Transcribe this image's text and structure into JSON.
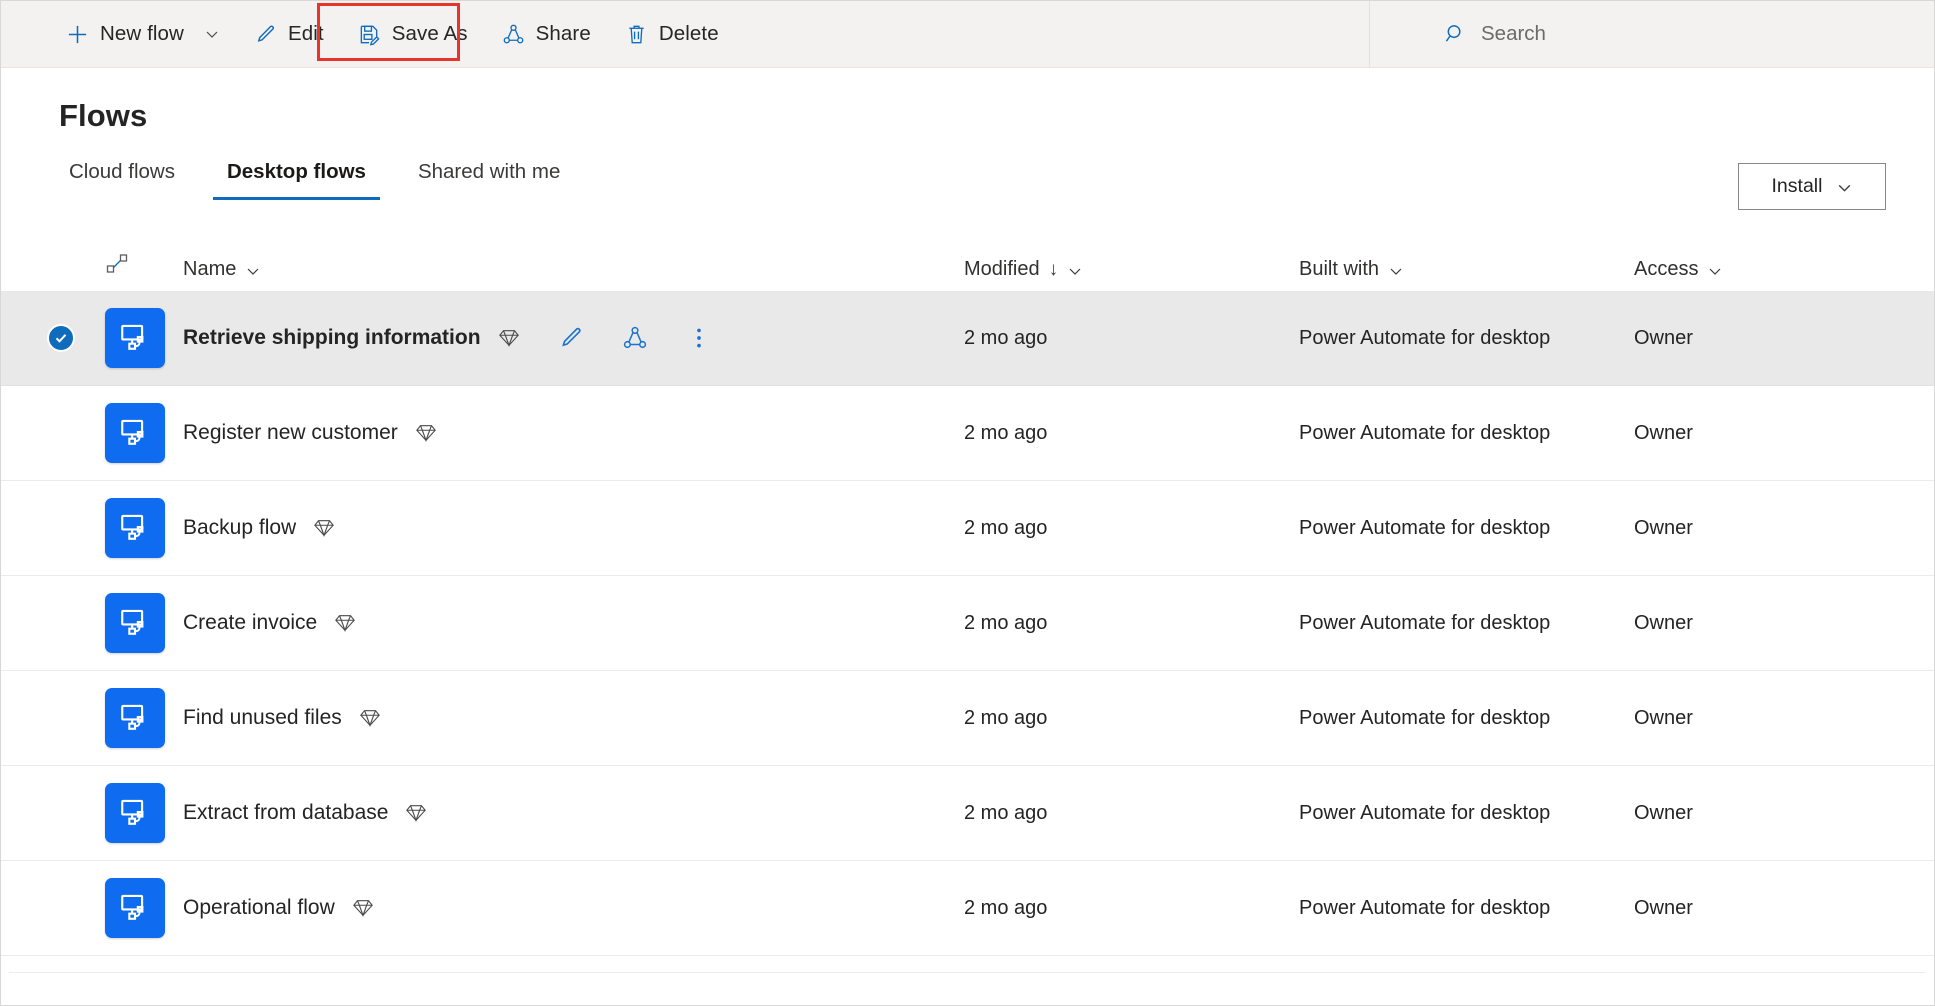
{
  "toolbar": {
    "items": [
      {
        "label": "New flow",
        "icon": "plus-icon",
        "has_chevron": true
      },
      {
        "label": "Edit",
        "icon": "pencil-icon",
        "has_chevron": false
      },
      {
        "label": "Save As",
        "icon": "save-as-icon",
        "has_chevron": false,
        "highlighted": true
      },
      {
        "label": "Share",
        "icon": "share-icon",
        "has_chevron": false
      },
      {
        "label": "Delete",
        "icon": "trash-icon",
        "has_chevron": false
      }
    ],
    "search": {
      "placeholder": "Search",
      "value": "",
      "icon": "search-icon"
    },
    "highlight_color": "#e8342a"
  },
  "header": {
    "title": "Flows",
    "install": {
      "label": "Install",
      "icon": "chevron-down-icon"
    }
  },
  "tabs": [
    {
      "label": "Cloud flows",
      "active": false
    },
    {
      "label": "Desktop flows",
      "active": true
    },
    {
      "label": "Shared with me",
      "active": false
    }
  ],
  "table": {
    "columns": {
      "type_icon": "flow-connector-icon",
      "name": "Name",
      "modified": "Modified",
      "modified_sort": "↓",
      "built_with": "Built with",
      "access": "Access"
    },
    "row_actions": [
      {
        "name": "edit-icon",
        "label": "Edit"
      },
      {
        "name": "share-icon",
        "label": "Share"
      },
      {
        "name": "more-icon",
        "label": "More commands"
      }
    ],
    "rows": [
      {
        "name": "Retrieve shipping information",
        "premium": true,
        "modified": "2 mo ago",
        "built_with": "Power Automate for desktop",
        "access": "Owner",
        "selected": true
      },
      {
        "name": "Register new customer",
        "premium": true,
        "modified": "2 mo ago",
        "built_with": "Power Automate for desktop",
        "access": "Owner",
        "selected": false
      },
      {
        "name": "Backup flow",
        "premium": true,
        "modified": "2 mo ago",
        "built_with": "Power Automate for desktop",
        "access": "Owner",
        "selected": false
      },
      {
        "name": "Create invoice",
        "premium": true,
        "modified": "2 mo ago",
        "built_with": "Power Automate for desktop",
        "access": "Owner",
        "selected": false
      },
      {
        "name": "Find unused files",
        "premium": true,
        "modified": "2 mo ago",
        "built_with": "Power Automate for desktop",
        "access": "Owner",
        "selected": false
      },
      {
        "name": "Extract from database",
        "premium": true,
        "modified": "2 mo ago",
        "built_with": "Power Automate for desktop",
        "access": "Owner",
        "selected": false
      },
      {
        "name": "Operational flow",
        "premium": true,
        "modified": "2 mo ago",
        "built_with": "Power Automate for desktop",
        "access": "Owner",
        "selected": false
      }
    ]
  },
  "colors": {
    "accent": "#0f6cbd",
    "tile_blue": "#0f6cf0",
    "command_bar_bg": "#f3f2f1",
    "selected_row_bg": "#e9e9e9",
    "highlight_red": "#e8342a"
  }
}
